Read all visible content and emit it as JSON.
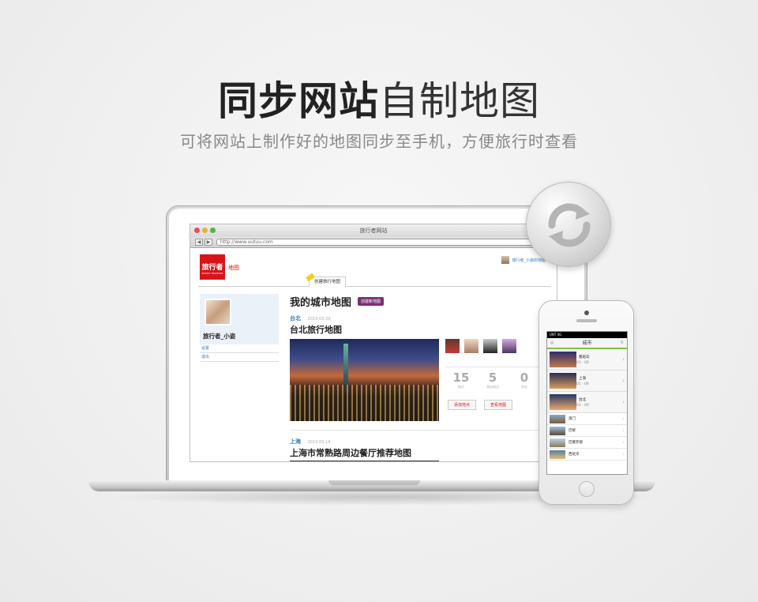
{
  "hero": {
    "title_bold": "同步网站",
    "title_light": "自制地图",
    "subtitle": "可将网站上制作好的地图同步至手机，方便旅行时查看"
  },
  "browser": {
    "window_title": "旅行者网站",
    "url": "http://www.uutuu.com",
    "back_icon": "◀",
    "forward_icon": "▶"
  },
  "site": {
    "logo_text": "旅行者",
    "logo_sub": "BOOKS TRAVELER",
    "nav_map": "地图",
    "top_user": "旅行者_小姿的地图",
    "tab_label": "创建旅行地图",
    "profile_name": "旅行者_小姿",
    "side_links": [
      "设置",
      "退出"
    ],
    "page_title": "我的城市地图",
    "new_map_button": "创建新地图",
    "maps": [
      {
        "city": "台北",
        "date": "2013-03-20",
        "title": "台北旅行地图",
        "stats": [
          {
            "num": "15",
            "label": "地点"
          },
          {
            "num": "5",
            "label": "游玩地点"
          },
          {
            "num": "0",
            "label": "评论"
          }
        ],
        "add_button": "添加地点",
        "view_button": "查看地图"
      },
      {
        "city": "上海",
        "date": "2013-03-14",
        "title": "上海市常熟路周边餐厅推荐地图"
      }
    ]
  },
  "phone": {
    "status": "UNT 4G",
    "header_title": "城市",
    "header_left": "◎",
    "header_right": "↻",
    "featured": [
      {
        "name": "塞班岛",
        "count_a": "01",
        "count_b": "00"
      },
      {
        "name": "上海",
        "count_a": "01",
        "count_b": "08"
      },
      {
        "name": "台北",
        "count_a": "01",
        "count_b": "00"
      }
    ],
    "others": [
      "澳门",
      "巴黎",
      "巴塞罗那",
      "西班牙"
    ]
  },
  "colors": {
    "brand_red": "#d8141a",
    "link_blue": "#3a7ac4",
    "button_purple": "#7a2e75",
    "phone_accent_green": "#7fc241"
  },
  "icons": {
    "sync": "sync-icon"
  }
}
